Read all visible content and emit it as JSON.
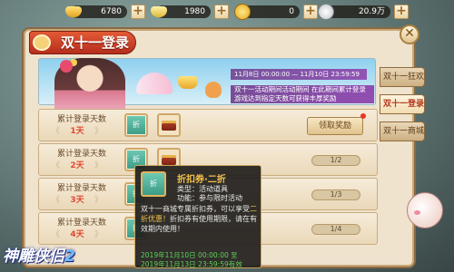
{
  "currencies": [
    {
      "icon": "gold-ingot-icon",
      "value": "6780"
    },
    {
      "icon": "silver-ingot-icon",
      "value": "1980"
    },
    {
      "icon": "coin-icon",
      "value": "0"
    },
    {
      "icon": "silver-coin-icon",
      "value": "20.9万"
    }
  ],
  "panel": {
    "title": "双十一登录",
    "close_glyph": "✕"
  },
  "banner": {
    "date_line": "11月8日 00:00:00 — 11月10日 23:59:59",
    "desc_line1": "双十一活动期间活动期间 在此期间累计登录",
    "desc_line2": "游戏达到指定天数可获得丰厚奖励"
  },
  "rows": [
    {
      "label": "累计登录天数",
      "days": "1天",
      "action": "领取奖励",
      "claimable": true,
      "progress": ""
    },
    {
      "label": "累计登录天数",
      "days": "2天",
      "action": "",
      "claimable": false,
      "progress": "1/2"
    },
    {
      "label": "累计登录天数",
      "days": "3天",
      "action": "",
      "claimable": false,
      "progress": "1/3"
    },
    {
      "label": "累计登录天数",
      "days": "4天",
      "action": "",
      "claimable": false,
      "progress": "1/4"
    }
  ],
  "ticket_text": "折",
  "side_tabs": [
    "双十一狂欢",
    "双十一登录",
    "双十一商城"
  ],
  "tooltip": {
    "name": "折扣券·二折",
    "type": "类型：活动道具",
    "func": "功能：参与限时活动",
    "desc_a": "双十一商城专属折扣券，可以享受",
    "desc_b": "二折优惠！",
    "desc_c": "折扣券有使用期限，请在有效期内使用！",
    "time1": "2019年11月10日 00:00:00 至",
    "time2": "2019年11月13日 23:59:59有效"
  },
  "logo": {
    "text_a": "神雕",
    "text_b": "侠侣",
    "text_c": "2"
  },
  "colors": {
    "title_red": "#c8381f",
    "tip_gold": "#f3c24a",
    "tip_green": "#5fd35a"
  }
}
